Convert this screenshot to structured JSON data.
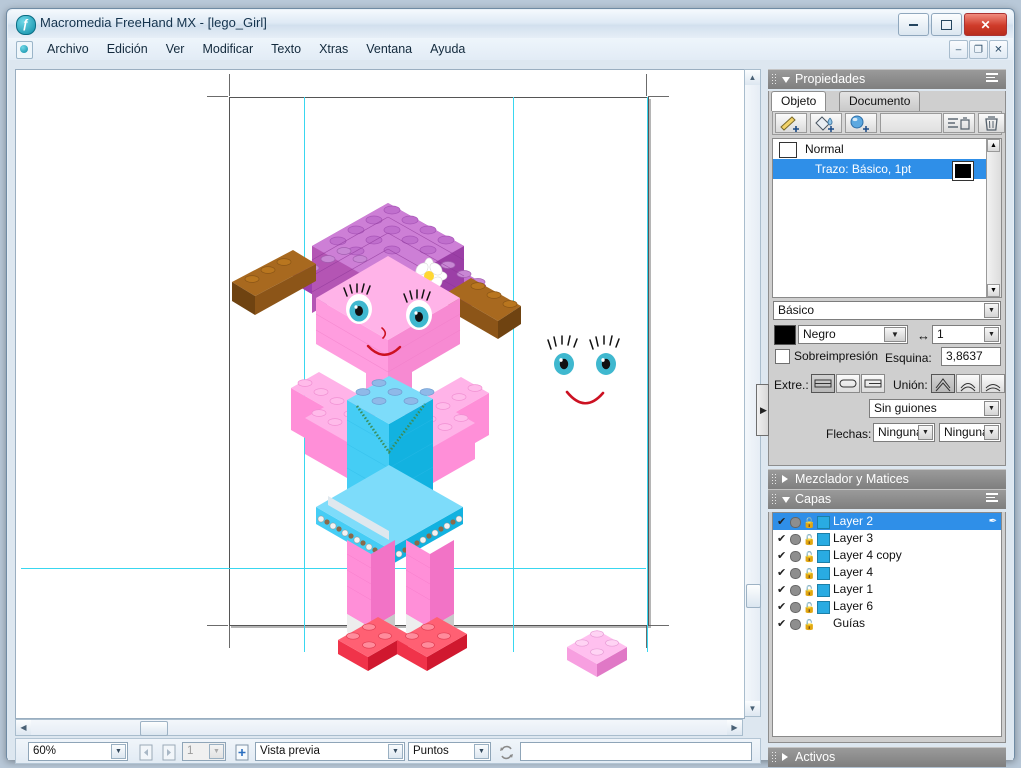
{
  "window": {
    "title": "Macromedia FreeHand MX - [lego_Girl]",
    "app_icon": "freehand-logo-icon",
    "minimize": "–",
    "maximize": "□",
    "close": "✕"
  },
  "menubar": {
    "doc_icon": "document-icon",
    "items": [
      "Archivo",
      "Edición",
      "Ver",
      "Modificar",
      "Texto",
      "Xtras",
      "Ventana",
      "Ayuda"
    ],
    "mdi": {
      "minimize": "–",
      "restore": "❐",
      "close": "✕"
    }
  },
  "statusbar": {
    "zoom": "60%",
    "prev_page_icon": "previous-page-icon",
    "next_page_icon": "next-page-icon",
    "page_number": "1",
    "add_page_icon": "add-page-icon",
    "view_mode": "Vista previa",
    "units": "Puntos",
    "sync_icon": "recycle-icon",
    "message": ""
  },
  "properties_panel": {
    "title": "Propiedades",
    "options_icon": "panel-options-icon",
    "tabs": [
      {
        "label": "Objeto",
        "active": true
      },
      {
        "label": "Documento",
        "active": false
      }
    ],
    "tools": [
      {
        "name": "add-stroke-icon",
        "glyph": "✎"
      },
      {
        "name": "add-fill-icon",
        "glyph": "🪣"
      },
      {
        "name": "add-effect-icon",
        "glyph": "●"
      },
      {
        "name": "delete-attribute-icon",
        "glyph": "☰"
      },
      {
        "name": "trash-icon",
        "glyph": "🗑"
      }
    ],
    "object_list": [
      {
        "label": "Normal",
        "selected": false,
        "swatch": "#ffffff"
      },
      {
        "label": "Trazo: Básico, 1pt",
        "selected": true,
        "swatch": "#000000"
      }
    ],
    "stroke": {
      "type": "Básico",
      "color_name": "Negro",
      "color_hex": "#000000",
      "overprint_label": "Sobreimpresión",
      "width_icon": "stroke-width-icon",
      "width": "1",
      "miter_label": "Esquina:",
      "miter_value": "3,8637",
      "cap_label": "Extre.:",
      "join_label": "Unión:",
      "dash": "Sin guiones",
      "arrows_label": "Flechas:",
      "arrow_start": "Ninguna",
      "arrow_end": "Ninguna"
    }
  },
  "mixer_panel": {
    "title": "Mezclador y Matices",
    "collapsed": true
  },
  "layers_panel": {
    "title": "Capas",
    "options_icon": "panel-options-icon",
    "rows": [
      {
        "name": "Layer 2",
        "selected": true,
        "color": "#29abe2",
        "visible": "✔",
        "lock": "🔓",
        "active_pen": true
      },
      {
        "name": "Layer 3",
        "selected": false,
        "color": "#29abe2",
        "visible": "✔",
        "lock": "🔓"
      },
      {
        "name": "Layer 4 copy",
        "selected": false,
        "color": "#29abe2",
        "visible": "✔",
        "lock": "🔓"
      },
      {
        "name": "Layer 4",
        "selected": false,
        "color": "#29abe2",
        "visible": "✔",
        "lock": "🔓"
      },
      {
        "name": "Layer 1",
        "selected": false,
        "color": "#29abe2",
        "visible": "✔",
        "lock": "🔓"
      },
      {
        "name": "Layer 6",
        "selected": false,
        "color": "#29abe2",
        "visible": "✔",
        "lock": "🔓"
      },
      {
        "name": "Guías",
        "selected": false,
        "color": "",
        "visible": "✔",
        "lock": "🔓"
      }
    ]
  },
  "assets_panel": {
    "title": "Activos",
    "collapsed": true
  },
  "canvas": {
    "artwork_title": "lego-girl-artwork",
    "colors": {
      "hat_purple": "#b455b4",
      "hat_purple_light": "#c884d6",
      "hair_brown": "#9a5c18",
      "face_pink": "#ff9ddf",
      "dress_cyan": "#29c3f0",
      "leg_pink": "#ff8fd8",
      "shoe_red": "#f0334a",
      "eye_blue": "#3fb8cf",
      "smile_red": "#cc1122",
      "guide_cyan": "#39d7f0"
    }
  }
}
